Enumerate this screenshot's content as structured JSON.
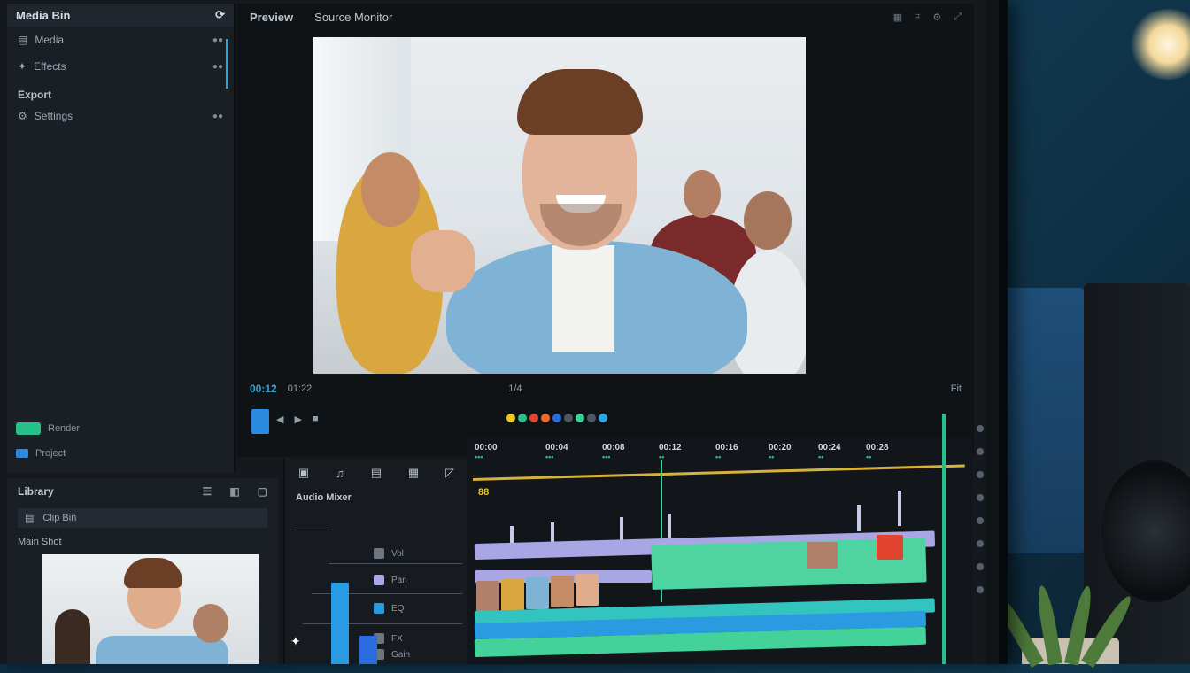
{
  "media_panel": {
    "title": "Media Bin",
    "items": [
      {
        "label": "Media",
        "meta": "●●"
      },
      {
        "label": "Effects",
        "meta": "●●"
      }
    ],
    "section": "Export",
    "section_items": [
      {
        "label": "Settings",
        "meta": "●●"
      }
    ],
    "footer": [
      {
        "label": "Render"
      },
      {
        "label": "Project"
      }
    ]
  },
  "preview": {
    "tab_active": "Preview",
    "tab_secondary": "Source Monitor",
    "timecode_left": "00:12",
    "timecode_mid": "01:22",
    "center_label": "1/4",
    "right_label": "Fit",
    "controls": [
      "◀",
      "▶",
      "■"
    ]
  },
  "thumb_panel": {
    "title": "Library",
    "bar_label": "Clip Bin",
    "sub_label": "Main Shot"
  },
  "fx_panel": {
    "title": "Audio Mixer",
    "rows": [
      "Vol",
      "Pan",
      "EQ",
      "FX",
      "Gain"
    ]
  },
  "timeline": {
    "ticks": [
      {
        "label": "00:00",
        "sub": "•••"
      },
      {
        "label": "00:04",
        "sub": "•••"
      },
      {
        "label": "00:08",
        "sub": "•••"
      },
      {
        "label": "00:12",
        "sub": "••"
      },
      {
        "label": "00:16",
        "sub": "••"
      },
      {
        "label": "00:20",
        "sub": "••"
      },
      {
        "label": "00:24",
        "sub": "••"
      },
      {
        "label": "00:28",
        "sub": "••"
      }
    ],
    "track_label": "88"
  },
  "colors": {
    "accent": "#2aa6e0",
    "green": "#27c08b",
    "yellow": "#d7b23a",
    "lavender": "#a9a6e6",
    "teal": "#34c4c0",
    "video_track": "#2a9be0",
    "audio_track": "#43d39a",
    "mint": "#4fd3a0"
  }
}
